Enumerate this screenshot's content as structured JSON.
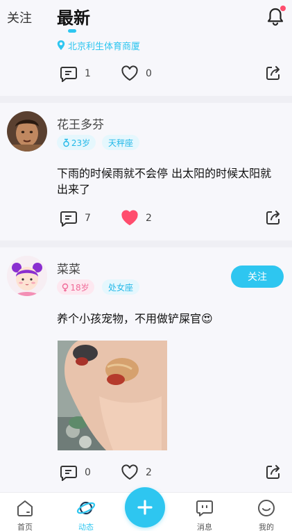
{
  "header": {
    "tab_follow": "关注",
    "tab_latest": "最新"
  },
  "post1": {
    "location": "北京利生体育商厦",
    "comments": "1",
    "likes": "0"
  },
  "post2": {
    "username": "花王多芬",
    "age_badge": "23岁",
    "gender": "male",
    "zodiac_badge": "天秤座",
    "text": "下雨的时候雨就不会停 出太阳的时候太阳就出来了",
    "comments": "7",
    "likes": "2",
    "liked": true
  },
  "post3": {
    "username": "菜菜",
    "age_badge": "18岁",
    "gender": "female",
    "zodiac_badge": "处女座",
    "follow_label": "关注",
    "text": "养个小孩宠物，不用做铲屎官",
    "emoji": "😍",
    "comments": "0",
    "likes": "2",
    "liked": false
  },
  "colors": {
    "accent": "#2ec6f0",
    "like_active": "#ff4d6d",
    "pink_badge": "#f06a98"
  },
  "nav": {
    "items": [
      {
        "label": "首页",
        "icon": "home-icon",
        "active": false
      },
      {
        "label": "动态",
        "icon": "planet-icon",
        "active": true
      },
      {
        "label": "消息",
        "icon": "message-icon",
        "active": false
      },
      {
        "label": "我的",
        "icon": "profile-icon",
        "active": false
      }
    ],
    "fab_icon": "plus-icon"
  }
}
